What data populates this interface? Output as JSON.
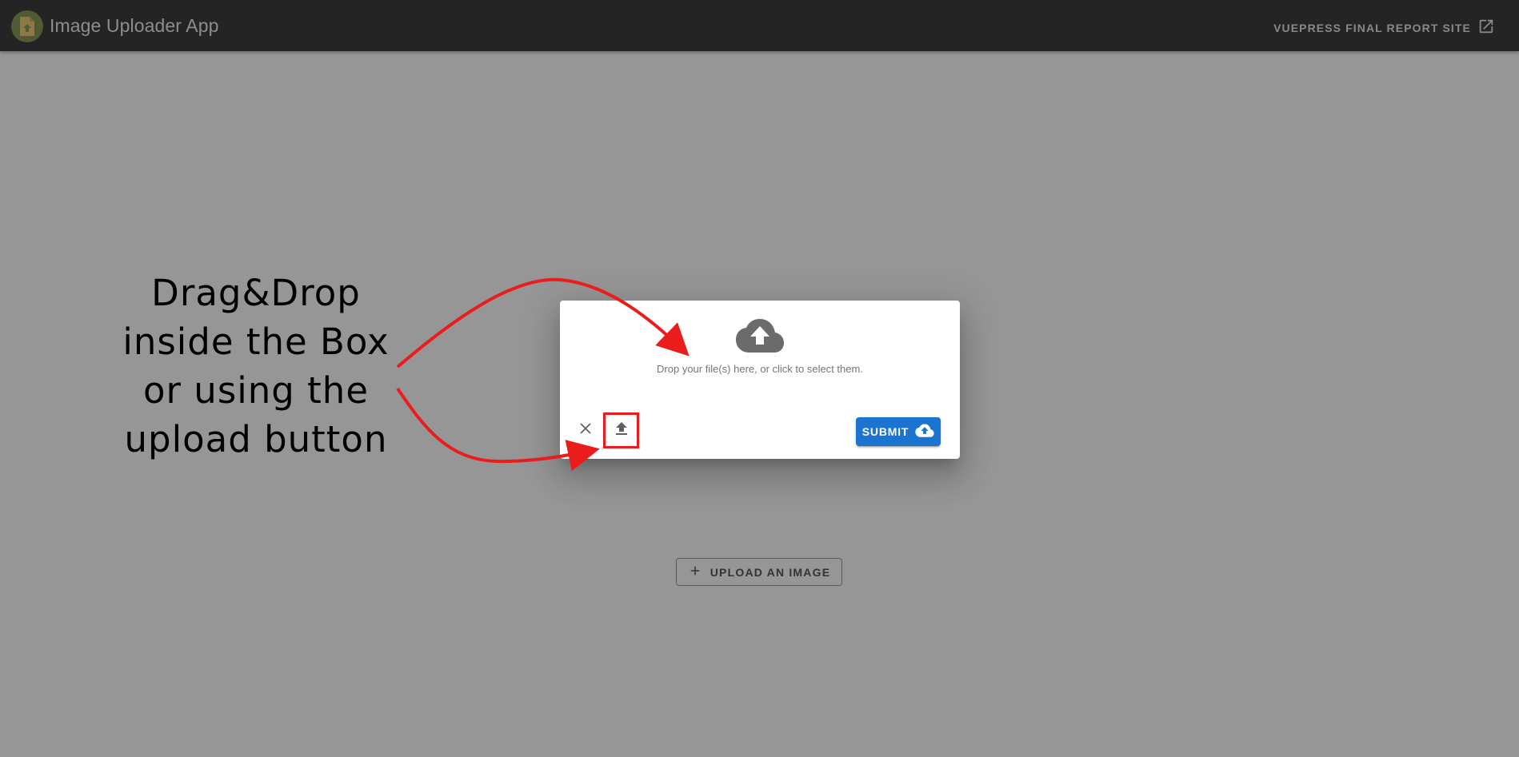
{
  "app_bar": {
    "title": "Image Uploader App",
    "report_link_label": "VUEPRESS FINAL REPORT SITE",
    "report_link_icon": "open-in-new-icon",
    "logo_icon": "file-upload-logo-icon"
  },
  "main": {
    "upload_button_label": "UPLOAD AN IMAGE",
    "upload_button_icon": "plus-icon"
  },
  "dialog": {
    "dropzone_icon": "cloud-upload-icon",
    "dropzone_text": "Drop your file(s) here, or click to select them.",
    "close_icon": "close-icon",
    "upload_icon": "upload-icon",
    "submit_label": "SUBMIT",
    "submit_icon": "cloud-upload-icon"
  },
  "annotation": {
    "lines": [
      "Drag&Drop",
      "inside the Box",
      "or using the",
      "upload button"
    ],
    "highlight_color": "#ea1c1c"
  },
  "colors": {
    "app_bar": "#272727",
    "primary": "#1b75d0",
    "scrim": "rgba(33,33,33,0.46)",
    "annotation_red": "#ea1c1c"
  }
}
